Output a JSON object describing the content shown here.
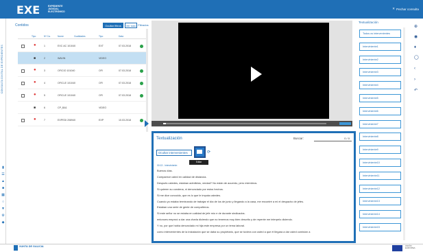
{
  "header": {
    "logo": "EXE",
    "logo_sub": "EXPEDIENTE JUDICIAL ELECTRÓNICO",
    "close_label": "Pechar consulta"
  },
  "sidebar_vertical": "CONSULTA DIXITAL DE EXPEDIENTES",
  "left_panel": {
    "title": "Contidos",
    "filter_buttons": [
      "Ocultar filtros",
      "Ver todo",
      "Filtrados"
    ],
    "columns": [
      "Tipo",
      "Nº Ca.",
      "Nome",
      "Cualidades",
      "Tipo",
      "Data"
    ],
    "rows": [
      {
        "n": "1",
        "code": "EXC AC  101040",
        "type": "EXT",
        "date": "07.03.2018",
        "kind": "doc"
      },
      {
        "n": "2",
        "code": "WAVIN",
        "type": "VIDEO",
        "date": "",
        "kind": "video",
        "selected": true
      },
      {
        "n": "3",
        "code": "OFICIO  101040",
        "type": "OFI",
        "date": "07.03.2018",
        "kind": "doc"
      },
      {
        "n": "4",
        "code": "OFICLE  101040",
        "type": "OFI",
        "date": "07.03.2018",
        "kind": "doc"
      },
      {
        "n": "5",
        "code": "OFICLE  101040",
        "type": "OFI",
        "date": "07.03.2018",
        "kind": "doc"
      },
      {
        "n": "6",
        "code": "CP_BA1",
        "type": "VIDEO",
        "date": "",
        "kind": "video"
      },
      {
        "n": "7",
        "code": "EXPEDI  208940",
        "type": "EXP",
        "date": "10.03.2018",
        "kind": "doc"
      }
    ]
  },
  "transcription": {
    "title": "Textualización",
    "search_label": "Buscar:",
    "search_value": "0 / 0",
    "hide_label": "Ocultar intervenientes",
    "tooltip": "Editar textualización",
    "timestamp": "00:13 - Interviniente:",
    "lines": [
      "Buenos días.",
      "Comparece usted en calidad de distancia.",
      "Después ustedes, estaban admitidos, verdad? No están de acuerdo, pero miembros.",
      "Si quieren su condena, ni denunciado por estos hechos.",
      "Si me dice conocido, que es lo que le imputa ustedes.",
      "Cuando yo estaba terminando de trabajar el día de los de junio y llegando a la casa, me encontré a mi el despacho de jefes.",
      "Estaban una serie de gente de compañeros.",
      "Si este señor no se estaba en calidad de jefe mío e de durante sindicados.",
      "entonces empezó a dar una charla diciendo que no tenemos muy bien descrito y de repente me interpelo diciendo.",
      "Y no, por que había denunciado mi hija este empresa por un tema laboral.",
      "como intervenientes de la instalación que se daba su propietario, que se tuviera con usted a que él llegara a dar usted comisión a"
    ]
  },
  "right_panel": {
    "title": "Textualización",
    "items": [
      "Todos os intervenientes",
      "Interviniente1",
      "Interviniente2",
      "Interviniente3",
      "Interviniente4",
      "Interviniente5",
      "Interviniente6",
      "Interviniente7",
      "Interviniente8",
      "Interviniente9",
      "Interviniente10",
      "Interviniente11",
      "Interviniente12",
      "Interviniente13",
      "Interviniente14",
      "Interviniente15"
    ]
  },
  "footer": {
    "org": "XUNTA DE GALICIA",
    "eu": "UNIÓN EUROPEA"
  },
  "colors": {
    "primary": "#1f6fb6",
    "selected_row": "#c3dff3",
    "ok": "#2aa14a"
  }
}
